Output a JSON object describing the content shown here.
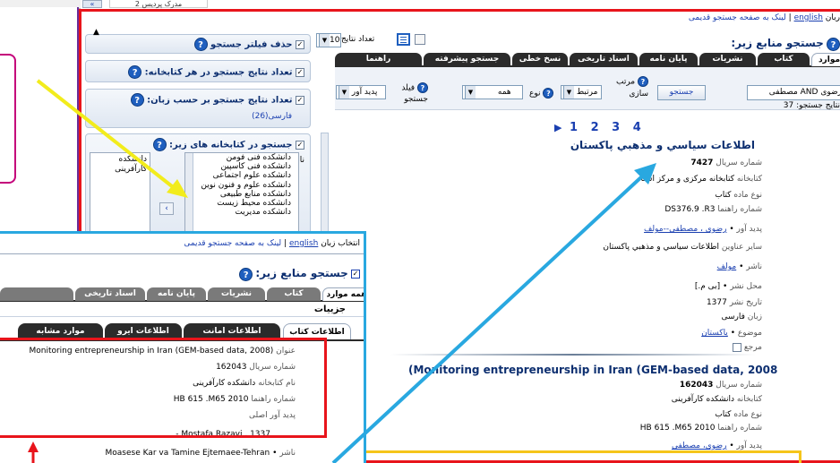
{
  "top_strip": {
    "label": "مدرک پردیس 2",
    "chevron": "«"
  },
  "back_panel": {
    "links": {
      "lang_prefix": "ربان",
      "lang": "english",
      "old_link": "لینک به صفحه جستجو قدیمی"
    },
    "search_title": "جستجو منابع زیر:",
    "tabs_row1": [
      "کتاب",
      "نشریات",
      "پایان نامه",
      "اسناد تاریخی",
      "نسخ خطی",
      "جستجو پیشرفته",
      "راهنما"
    ],
    "tabs_row2_label": "موارد",
    "search": {
      "query": "مصطفی AND رضوی",
      "button": "جستجو",
      "sort_label": "مرتب سازی",
      "sort_value": "مرتبط",
      "type_label": "نوع",
      "type_value": "همه",
      "field_label": "فیلد جستجو",
      "field_value": "پدید آور",
      "results_label": "نتایج جستجو:",
      "results_count": "37"
    },
    "filters": {
      "remove_filter": "حذف فیلتر جستجو",
      "results_count_label": "تعداد نتایج",
      "results_count_value": "10",
      "per_library": "تعداد نتایج جستجو در هر کتابخانه:",
      "per_language": "تعداد نتایج جستجو بر حسب زبان:",
      "language_value": "فارسی(26)",
      "search_libraries": "جستجو در کتابخانه های زیر:",
      "name_label": "نام",
      "libraries": [
        "دانشکده فنی فومن",
        "دانشکده فنی کاسپین",
        "دانشکده علوم اجتماعی",
        "دانشکده علوم و فنون نوین",
        "دانشکده منابع طبیعی",
        "دانشکده محیط زیست",
        "دانشکده مدیریت"
      ],
      "selected_libraries": [
        "دانشکده",
        "کارآفرینی"
      ]
    },
    "pagination": [
      "1",
      "2",
      "3",
      "4"
    ],
    "result1": {
      "title": "اطلاعات سياسي و مذهبي پاكستان",
      "serial_label": "شماره سریال",
      "serial": "7427",
      "library_label": "کتابخانه",
      "library": "کتابخانه مرکزی و مرکز اسناد",
      "doctype_label": "نوع ماده",
      "doctype": "کتاب",
      "callno_label": "شماره راهنما",
      "callno": "DS376.9 .R3",
      "author_label": "پدید آور",
      "author": "رضوی ، مصطفی--مولف",
      "other_title_label": "سایر عناوین",
      "other_title": "اطلاعات سياسي و مذهبي پاكستان",
      "publisher_label": "ناشر",
      "publisher": "مولف",
      "place_label": "محل نشر",
      "place": "[بی م.]",
      "date_label": "تاریخ نشر",
      "date": "1377",
      "lang_label": "زبان",
      "lang": "فارسی",
      "subject_label": "موضوع",
      "subject": "پاكستان",
      "ref_label": "مرجع"
    },
    "result2": {
      "title": "(Monitoring entrepreneurship in Iran (GEM-based data, 2008",
      "serial_label": "شماره سریال",
      "serial": "162043",
      "library_label": "کتابخانه",
      "library": "دانشکده کارآفرینی",
      "doctype_label": "نوع ماده",
      "doctype": "کتاب",
      "callno_label": "شماره راهنما",
      "callno": "HB 615 .M65 2010",
      "author_label": "پدید آور",
      "author": "رضوی، مصطفی"
    }
  },
  "front_panel": {
    "links": {
      "lang_prefix": "انتخاب زبان",
      "lang": "english",
      "old_link": "لینک به صفحه جستجو قدیمی"
    },
    "search_title": "جستجو منابع زیر:",
    "tabs": [
      "همه موارد",
      "کتاب",
      "نشریات",
      "پایان نامه",
      "اسناد تاریخی"
    ],
    "details_label": "جزییات",
    "detail_tabs": [
      "اطلاعات کتاب",
      "اطلاعات امانت",
      "اطلاعات ایرو",
      "موارد مشابه"
    ],
    "fields": [
      {
        "label": "عنوان",
        "value": "(Monitoring entrepreneurship in Iran (GEM-based data, 2008"
      },
      {
        "label": "شماره سریال",
        "value": "162043"
      },
      {
        "label": "نام کتابخانه",
        "value": "دانشکده کارآفرینی"
      },
      {
        "label": "شماره راهنما",
        "value": "HB 615 .M65 2010"
      },
      {
        "label": "پدید آور اصلی",
        "value": ""
      },
      {
        "label": "",
        "value": "Mostafa Razavi , 1337 -"
      }
    ],
    "publisher_label": "ناشر",
    "publisher": "Moasese Kar va Tamine Ejtemaee-Tehran"
  },
  "colors": {
    "red_box": "#e8141b",
    "blue_box": "#29a8e0",
    "yellow_box": "#f5c51a",
    "yellow_arrow": "#f2ec1c",
    "blue_arrow": "#29a8e0",
    "purple_frame": "#6a2c9a",
    "pink_box": "#c4007a"
  }
}
